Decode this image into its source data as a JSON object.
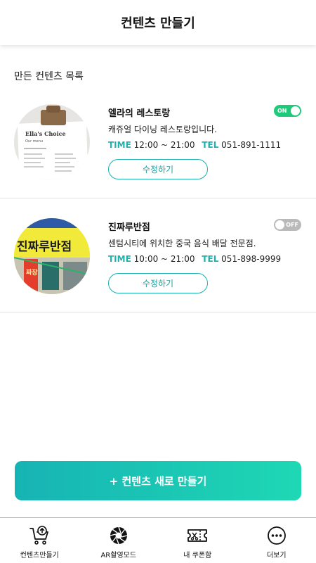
{
  "header": {
    "title": "컨텐츠 만들기"
  },
  "section": {
    "title": "만든 컨텐츠 목록"
  },
  "contents": [
    {
      "name": "엘라의 레스토랑",
      "description": "캐쥬얼 다이닝 레스토랑입니다.",
      "time_label": "TIME",
      "time": "12:00 ~ 21:00",
      "tel_label": "TEL",
      "tel": "051-891-1111",
      "toggle": "ON",
      "toggle_on": true,
      "edit_label": "수정하기",
      "thumbnail": {
        "menu_title": "Ella's Choice",
        "menu_sub": "Our menu"
      }
    },
    {
      "name": "진짜루반점",
      "description": "센텀시티에 위치한 중국 음식 배달 전문점.",
      "time_label": "TIME",
      "time": "10:00 ~ 21:00",
      "tel_label": "TEL",
      "tel": "051-898-9999",
      "toggle": "OFF",
      "toggle_on": false,
      "edit_label": "수정하기",
      "thumbnail": {
        "sign_text": "진짜루반점",
        "side_text": "짜장"
      }
    }
  ],
  "create_button": {
    "label": "+ 컨텐츠 새로 만들기"
  },
  "tabs": [
    {
      "label": "컨텐츠만들기",
      "icon": "cart-upload-icon"
    },
    {
      "label": "AR촬영모드",
      "icon": "camera-aperture-icon"
    },
    {
      "label": "내 쿠폰함",
      "icon": "coupon-ticket-icon"
    },
    {
      "label": "더보기",
      "icon": "more-dots-icon"
    }
  ],
  "colors": {
    "accent": "#1bb2b0",
    "toggle_on": "#1ec97a",
    "toggle_off": "#b9b9b9",
    "button_gradient_start": "#17b3b4",
    "button_gradient_end": "#1ed8b4"
  }
}
